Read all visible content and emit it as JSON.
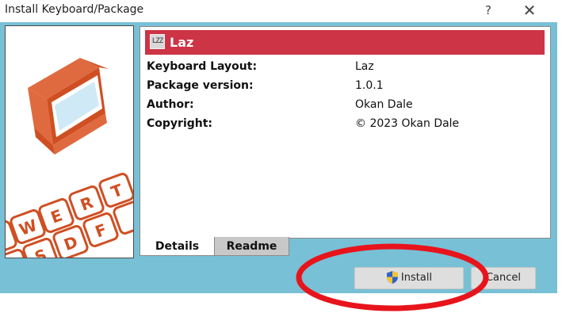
{
  "window": {
    "title": "Install Keyboard/Package",
    "help_glyph": "?",
    "close_glyph": "✕"
  },
  "package": {
    "icon_text": "LZZ",
    "name": "Laz",
    "header_color": "#cd3445"
  },
  "details": [
    {
      "label": "Keyboard Layout:",
      "value": "Laz"
    },
    {
      "label": "Package version:",
      "value": "1.0.1"
    },
    {
      "label": "Author:",
      "value": "Okan Dale"
    },
    {
      "label": "Copyright:",
      "value": "© 2023 Okan Dale"
    }
  ],
  "tabs": [
    {
      "label": "Details",
      "active": true
    },
    {
      "label": "Readme",
      "active": false
    }
  ],
  "buttons": {
    "install_label": "Install",
    "cancel_label": "Cancel"
  },
  "side_image": {
    "keys": [
      "W",
      "E",
      "R",
      "T",
      "S",
      "D",
      "F"
    ]
  },
  "colors": {
    "panel_bg": "#78c0d6",
    "highlight": "#e8141c",
    "box_orange": "#e06a3f"
  }
}
